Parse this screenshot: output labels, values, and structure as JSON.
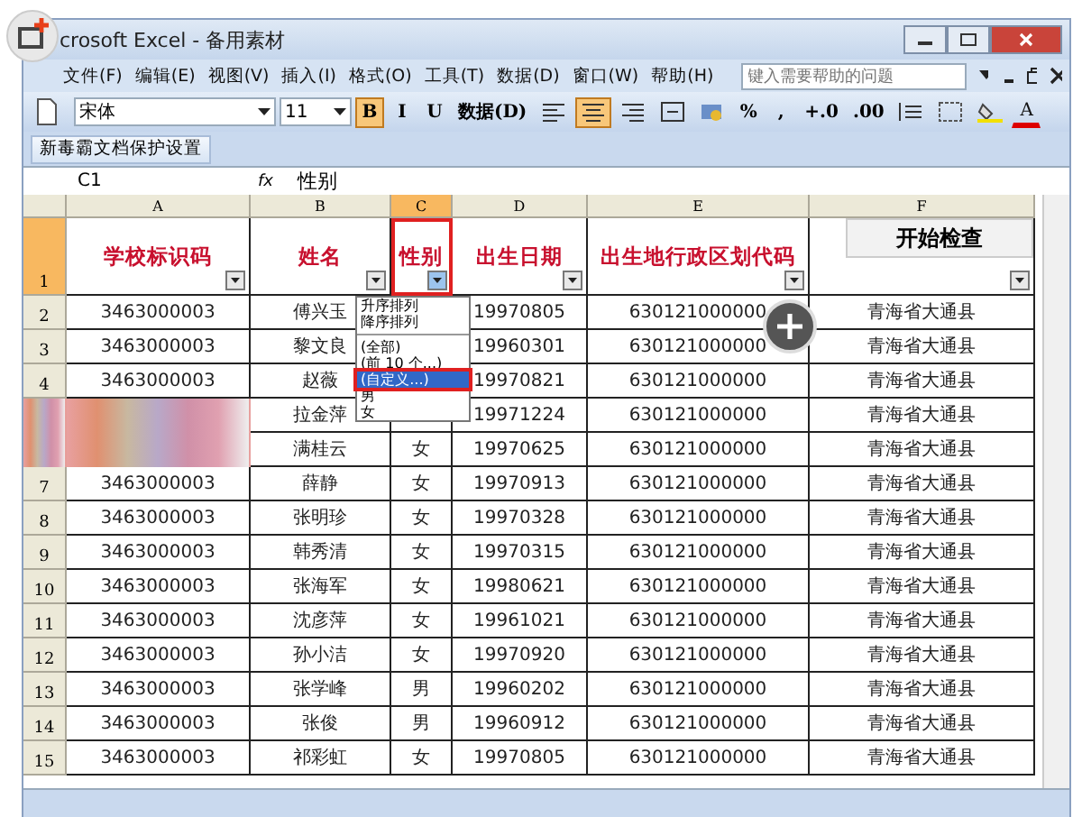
{
  "window": {
    "title": "crosoft Excel - 备用素材"
  },
  "menu": [
    "文件(F)",
    "编辑(E)",
    "视图(V)",
    "插入(I)",
    "格式(O)",
    "工具(T)",
    "数据(D)",
    "窗口(W)",
    "帮助(H)"
  ],
  "help_field": {
    "placeholder": "键入需要帮助的问题"
  },
  "toolbar": {
    "font": "宋体",
    "size": "11",
    "buttons": [
      {
        "kind": "text",
        "label": "B",
        "selected": true
      },
      {
        "kind": "text",
        "label": "I",
        "selected": false
      },
      {
        "kind": "text",
        "label": "U",
        "selected": false
      },
      {
        "kind": "menu",
        "label": "数据(D)",
        "selected": false
      },
      {
        "kind": "align-left",
        "selected": false
      },
      {
        "kind": "align-center",
        "selected": true
      },
      {
        "kind": "align-right",
        "selected": false
      },
      {
        "kind": "merge",
        "selected": false
      },
      {
        "kind": "currency",
        "selected": false
      },
      {
        "kind": "text",
        "label": "%",
        "selected": false
      },
      {
        "kind": "text",
        "label": ",",
        "selected": false
      },
      {
        "kind": "text",
        "label": "+.0",
        "selected": false
      },
      {
        "kind": "text",
        "label": ".00",
        "selected": false
      },
      {
        "kind": "indent",
        "selected": false
      },
      {
        "kind": "borders",
        "selected": false
      },
      {
        "kind": "fill",
        "selected": false
      },
      {
        "kind": "fontcolor",
        "label": "A",
        "selected": false
      }
    ]
  },
  "custom_toolbar": {
    "label": "新毒霸文档保护设置"
  },
  "formula_bar": {
    "cell": "C1",
    "fx": "fx",
    "value": "性别"
  },
  "columns": [
    {
      "label": "A",
      "selected": false
    },
    {
      "label": "B",
      "selected": false
    },
    {
      "label": "C",
      "selected": true
    },
    {
      "label": "D",
      "selected": false
    },
    {
      "label": "E",
      "selected": false
    },
    {
      "label": "F",
      "selected": false
    }
  ],
  "header_row": {
    "row": "1",
    "cells": [
      {
        "text": "学校标识码",
        "highlighted": false
      },
      {
        "text": "姓名",
        "highlighted": false
      },
      {
        "text": "性别",
        "highlighted": true
      },
      {
        "text": "出生日期",
        "highlighted": false
      },
      {
        "text": "出生地行政区划代码",
        "highlighted": false
      },
      {
        "text": "",
        "highlighted": false
      }
    ]
  },
  "check_button": {
    "label": "开始检查"
  },
  "rows": [
    {
      "row": "2",
      "cells": [
        "3463000003",
        "傅兴玉",
        "",
        "19970805",
        "630121000000",
        "青海省大通县"
      ]
    },
    {
      "row": "3",
      "cells": [
        "3463000003",
        "黎文良",
        "",
        "19960301",
        "630121000000",
        "青海省大通县"
      ]
    },
    {
      "row": "4",
      "cells": [
        "3463000003",
        "赵薇",
        "",
        "19970821",
        "630121000000",
        "青海省大通县"
      ]
    },
    {
      "row": "",
      "cells": [
        "",
        "拉金萍",
        "",
        "19971224",
        "630121000000",
        "青海省大通县"
      ]
    },
    {
      "row": "",
      "cells": [
        "",
        "满桂云",
        "女",
        "19970625",
        "630121000000",
        "青海省大通县"
      ]
    },
    {
      "row": "7",
      "cells": [
        "3463000003",
        "薛静",
        "女",
        "19970913",
        "630121000000",
        "青海省大通县"
      ]
    },
    {
      "row": "8",
      "cells": [
        "3463000003",
        "张明珍",
        "女",
        "19970328",
        "630121000000",
        "青海省大通县"
      ]
    },
    {
      "row": "9",
      "cells": [
        "3463000003",
        "韩秀清",
        "女",
        "19970315",
        "630121000000",
        "青海省大通县"
      ]
    },
    {
      "row": "10",
      "cells": [
        "3463000003",
        "张海军",
        "女",
        "19980621",
        "630121000000",
        "青海省大通县"
      ]
    },
    {
      "row": "11",
      "cells": [
        "3463000003",
        "沈彦萍",
        "女",
        "19961021",
        "630121000000",
        "青海省大通县"
      ]
    },
    {
      "row": "12",
      "cells": [
        "3463000003",
        "孙小洁",
        "女",
        "19970920",
        "630121000000",
        "青海省大通县"
      ]
    },
    {
      "row": "13",
      "cells": [
        "3463000003",
        "张学峰",
        "男",
        "19960202",
        "630121000000",
        "青海省大通县"
      ]
    },
    {
      "row": "14",
      "cells": [
        "3463000003",
        "张俊",
        "男",
        "19960912",
        "630121000000",
        "青海省大通县"
      ]
    },
    {
      "row": "15",
      "cells": [
        "3463000003",
        "祁彩虹",
        "女",
        "19970805",
        "630121000000",
        "青海省大通县"
      ]
    }
  ],
  "filter_menu": [
    {
      "label": "升序排列",
      "selected": false
    },
    {
      "label": "降序排列",
      "selected": false
    },
    {
      "label": "(全部)",
      "selected": false
    },
    {
      "label": "(前 10 个...)",
      "selected": false
    },
    {
      "label": "(自定义...)",
      "selected": true
    },
    {
      "label": "男",
      "selected": false
    },
    {
      "label": "女",
      "selected": false
    }
  ]
}
